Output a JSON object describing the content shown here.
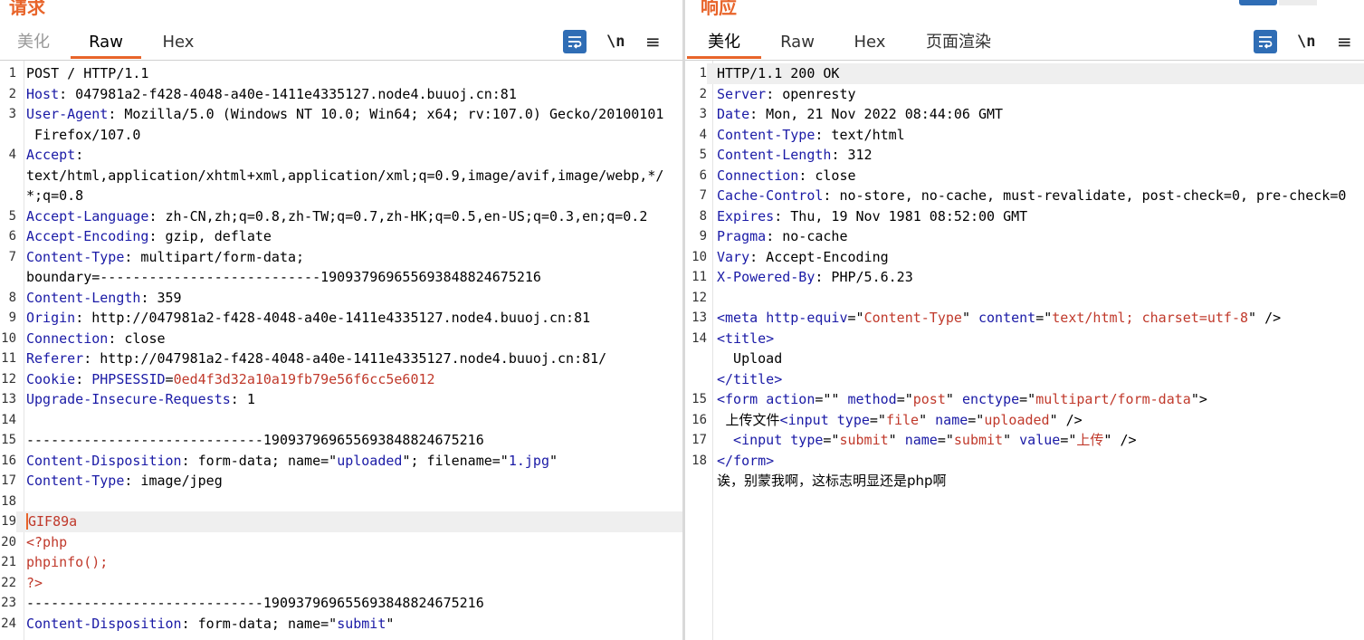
{
  "request": {
    "title": "请求",
    "tabs": [
      "美化",
      "Raw",
      "Hex"
    ],
    "active_tab": "Raw",
    "newline_label": "\\n",
    "menu_label": "≡",
    "lines": [
      {
        "n": "1",
        "parts": [
          {
            "c": "v",
            "t": "POST / HTTP/1.1"
          }
        ]
      },
      {
        "n": "2",
        "parts": [
          {
            "c": "k",
            "t": "Host"
          },
          {
            "c": "v",
            "t": ": 047981a2-f428-4048-a40e-1411e4335127.node4.buuoj.cn:81"
          }
        ]
      },
      {
        "n": "3",
        "parts": [
          {
            "c": "k",
            "t": "User-Agent"
          },
          {
            "c": "v",
            "t": ": Mozilla/5.0 (Windows NT 10.0; Win64; x64; rv:107.0) Gecko/20100101"
          }
        ]
      },
      {
        "n": "",
        "parts": [
          {
            "c": "v",
            "t": " Firefox/107.0"
          }
        ]
      },
      {
        "n": "4",
        "parts": [
          {
            "c": "k",
            "t": "Accept"
          },
          {
            "c": "v",
            "t": ":"
          }
        ]
      },
      {
        "n": "",
        "parts": [
          {
            "c": "v",
            "t": "text/html,application/xhtml+xml,application/xml;q=0.9,image/avif,image/webp,*/"
          }
        ]
      },
      {
        "n": "",
        "parts": [
          {
            "c": "v",
            "t": "*;q=0.8"
          }
        ]
      },
      {
        "n": "5",
        "parts": [
          {
            "c": "k",
            "t": "Accept-Language"
          },
          {
            "c": "v",
            "t": ": zh-CN,zh;q=0.8,zh-TW;q=0.7,zh-HK;q=0.5,en-US;q=0.3,en;q=0.2"
          }
        ]
      },
      {
        "n": "6",
        "parts": [
          {
            "c": "k",
            "t": "Accept-Encoding"
          },
          {
            "c": "v",
            "t": ": gzip, deflate"
          }
        ]
      },
      {
        "n": "7",
        "parts": [
          {
            "c": "k",
            "t": "Content-Type"
          },
          {
            "c": "v",
            "t": ": multipart/form-data;"
          }
        ]
      },
      {
        "n": "",
        "parts": [
          {
            "c": "v",
            "t": "boundary=---------------------------190937969655693848824675216"
          }
        ]
      },
      {
        "n": "8",
        "parts": [
          {
            "c": "k",
            "t": "Content-Length"
          },
          {
            "c": "v",
            "t": ": 359"
          }
        ]
      },
      {
        "n": "9",
        "parts": [
          {
            "c": "k",
            "t": "Origin"
          },
          {
            "c": "v",
            "t": ": http://047981a2-f428-4048-a40e-1411e4335127.node4.buuoj.cn:81"
          }
        ]
      },
      {
        "n": "10",
        "parts": [
          {
            "c": "k",
            "t": "Connection"
          },
          {
            "c": "v",
            "t": ": close"
          }
        ]
      },
      {
        "n": "11",
        "parts": [
          {
            "c": "k",
            "t": "Referer"
          },
          {
            "c": "v",
            "t": ": http://047981a2-f428-4048-a40e-1411e4335127.node4.buuoj.cn:81/"
          }
        ]
      },
      {
        "n": "12",
        "parts": [
          {
            "c": "k",
            "t": "Cookie"
          },
          {
            "c": "v",
            "t": ": "
          },
          {
            "c": "k",
            "t": "PHPSESSID"
          },
          {
            "c": "v",
            "t": "="
          },
          {
            "c": "s",
            "t": "0ed4f3d32a10a19fb79e56f6cc5e6012"
          }
        ]
      },
      {
        "n": "13",
        "parts": [
          {
            "c": "k",
            "t": "Upgrade-Insecure-Requests"
          },
          {
            "c": "v",
            "t": ": 1"
          }
        ]
      },
      {
        "n": "14",
        "parts": [
          {
            "c": "v",
            "t": ""
          }
        ]
      },
      {
        "n": "15",
        "parts": [
          {
            "c": "v",
            "t": "-----------------------------190937969655693848824675216"
          }
        ]
      },
      {
        "n": "16",
        "parts": [
          {
            "c": "k",
            "t": "Content-Disposition"
          },
          {
            "c": "v",
            "t": ": form-data; name=\""
          },
          {
            "c": "t",
            "t": "uploaded"
          },
          {
            "c": "v",
            "t": "\"; filename=\""
          },
          {
            "c": "t",
            "t": "1.jpg"
          },
          {
            "c": "v",
            "t": "\""
          }
        ]
      },
      {
        "n": "17",
        "parts": [
          {
            "c": "k",
            "t": "Content-Type"
          },
          {
            "c": "v",
            "t": ": image/jpeg"
          }
        ]
      },
      {
        "n": "18",
        "parts": [
          {
            "c": "v",
            "t": ""
          }
        ]
      },
      {
        "n": "19",
        "hl": true,
        "parts": [
          {
            "c": "s caret",
            "t": "GIF89a"
          }
        ]
      },
      {
        "n": "20",
        "parts": [
          {
            "c": "s",
            "t": "<?php"
          }
        ]
      },
      {
        "n": "21",
        "parts": [
          {
            "c": "s",
            "t": "phpinfo();"
          }
        ]
      },
      {
        "n": "22",
        "parts": [
          {
            "c": "s",
            "t": "?>"
          }
        ]
      },
      {
        "n": "23",
        "parts": [
          {
            "c": "v",
            "t": "-----------------------------190937969655693848824675216"
          }
        ]
      },
      {
        "n": "24",
        "parts": [
          {
            "c": "k",
            "t": "Content-Disposition"
          },
          {
            "c": "v",
            "t": ": form-data; name=\""
          },
          {
            "c": "t",
            "t": "submit"
          },
          {
            "c": "v",
            "t": "\""
          }
        ]
      }
    ]
  },
  "response": {
    "title": "响应",
    "tabs": [
      "美化",
      "Raw",
      "Hex",
      "页面渲染"
    ],
    "active_tab": "美化",
    "newline_label": "\\n",
    "menu_label": "≡",
    "lines": [
      {
        "n": "1",
        "hl": true,
        "parts": [
          {
            "c": "v",
            "t": "HTTP/1.1 200 OK"
          }
        ]
      },
      {
        "n": "2",
        "parts": [
          {
            "c": "k",
            "t": "Server"
          },
          {
            "c": "v",
            "t": ": openresty"
          }
        ]
      },
      {
        "n": "3",
        "parts": [
          {
            "c": "k",
            "t": "Date"
          },
          {
            "c": "v",
            "t": ": Mon, 21 Nov 2022 08:44:06 GMT"
          }
        ]
      },
      {
        "n": "4",
        "parts": [
          {
            "c": "k",
            "t": "Content-Type"
          },
          {
            "c": "v",
            "t": ": text/html"
          }
        ]
      },
      {
        "n": "5",
        "parts": [
          {
            "c": "k",
            "t": "Content-Length"
          },
          {
            "c": "v",
            "t": ": 312"
          }
        ]
      },
      {
        "n": "6",
        "parts": [
          {
            "c": "k",
            "t": "Connection"
          },
          {
            "c": "v",
            "t": ": close"
          }
        ]
      },
      {
        "n": "7",
        "parts": [
          {
            "c": "k",
            "t": "Cache-Control"
          },
          {
            "c": "v",
            "t": ": no-store, no-cache, must-revalidate, post-check=0, pre-check=0"
          }
        ]
      },
      {
        "n": "8",
        "parts": [
          {
            "c": "k",
            "t": "Expires"
          },
          {
            "c": "v",
            "t": ": Thu, 19 Nov 1981 08:52:00 GMT"
          }
        ]
      },
      {
        "n": "9",
        "parts": [
          {
            "c": "k",
            "t": "Pragma"
          },
          {
            "c": "v",
            "t": ": no-cache"
          }
        ]
      },
      {
        "n": "10",
        "parts": [
          {
            "c": "k",
            "t": "Vary"
          },
          {
            "c": "v",
            "t": ": Accept-Encoding"
          }
        ]
      },
      {
        "n": "11",
        "parts": [
          {
            "c": "k",
            "t": "X-Powered-By"
          },
          {
            "c": "v",
            "t": ": PHP/5.6.23"
          }
        ]
      },
      {
        "n": "12",
        "parts": [
          {
            "c": "v",
            "t": ""
          }
        ]
      },
      {
        "n": "13",
        "parts": [
          {
            "c": "t",
            "t": "<meta "
          },
          {
            "c": "k",
            "t": "http-equiv"
          },
          {
            "c": "v",
            "t": "=\""
          },
          {
            "c": "s",
            "t": "Content-Type"
          },
          {
            "c": "v",
            "t": "\" "
          },
          {
            "c": "k",
            "t": "content"
          },
          {
            "c": "v",
            "t": "=\""
          },
          {
            "c": "s",
            "t": "text/html; charset=utf-8"
          },
          {
            "c": "v",
            "t": "\" />"
          }
        ]
      },
      {
        "n": "",
        "parts": [
          {
            "c": "v",
            "t": ""
          }
        ]
      },
      {
        "n": "14",
        "parts": [
          {
            "c": "t",
            "t": "<title>"
          }
        ]
      },
      {
        "n": "",
        "parts": [
          {
            "c": "v",
            "t": "  Upload"
          }
        ]
      },
      {
        "n": "",
        "parts": [
          {
            "c": "t",
            "t": "</title>"
          }
        ]
      },
      {
        "n": "15",
        "parts": [
          {
            "c": "t",
            "t": "<form "
          },
          {
            "c": "k",
            "t": "action"
          },
          {
            "c": "v",
            "t": "=\"\" "
          },
          {
            "c": "k",
            "t": "method"
          },
          {
            "c": "v",
            "t": "=\""
          },
          {
            "c": "s",
            "t": "post"
          },
          {
            "c": "v",
            "t": "\" "
          },
          {
            "c": "k",
            "t": "enctype"
          },
          {
            "c": "v",
            "t": "=\""
          },
          {
            "c": "s",
            "t": "multipart/form-data"
          },
          {
            "c": "v",
            "t": "\">"
          }
        ]
      },
      {
        "n": "16",
        "parts": [
          {
            "c": "v cjk",
            "t": "  上传文件"
          },
          {
            "c": "t",
            "t": "<input "
          },
          {
            "c": "k",
            "t": "type"
          },
          {
            "c": "v",
            "t": "=\""
          },
          {
            "c": "s",
            "t": "file"
          },
          {
            "c": "v",
            "t": "\" "
          },
          {
            "c": "k",
            "t": "name"
          },
          {
            "c": "v",
            "t": "=\""
          },
          {
            "c": "s",
            "t": "uploaded"
          },
          {
            "c": "v",
            "t": "\" />"
          }
        ]
      },
      {
        "n": "17",
        "parts": [
          {
            "c": "t",
            "t": "  <input "
          },
          {
            "c": "k",
            "t": "type"
          },
          {
            "c": "v",
            "t": "=\""
          },
          {
            "c": "s",
            "t": "submit"
          },
          {
            "c": "v",
            "t": "\" "
          },
          {
            "c": "k",
            "t": "name"
          },
          {
            "c": "v",
            "t": "=\""
          },
          {
            "c": "s",
            "t": "submit"
          },
          {
            "c": "v",
            "t": "\" "
          },
          {
            "c": "k",
            "t": "value"
          },
          {
            "c": "v",
            "t": "=\""
          },
          {
            "c": "s cjk",
            "t": "上传"
          },
          {
            "c": "v",
            "t": "\" />"
          }
        ]
      },
      {
        "n": "18",
        "parts": [
          {
            "c": "t",
            "t": "</form>"
          }
        ]
      },
      {
        "n": "",
        "parts": [
          {
            "c": "v cjk",
            "t": "诶，别蒙我啊，这标志明显还是php啊"
          }
        ]
      }
    ]
  },
  "colors": {
    "accent": "#e8642a",
    "key": "#1a1aa6",
    "string": "#c0392b",
    "wrap_button": "#2f6db5"
  },
  "icons": {
    "wrap": "wrap-lines-icon",
    "newline": "newline-icon",
    "menu": "hamburger-menu-icon"
  }
}
